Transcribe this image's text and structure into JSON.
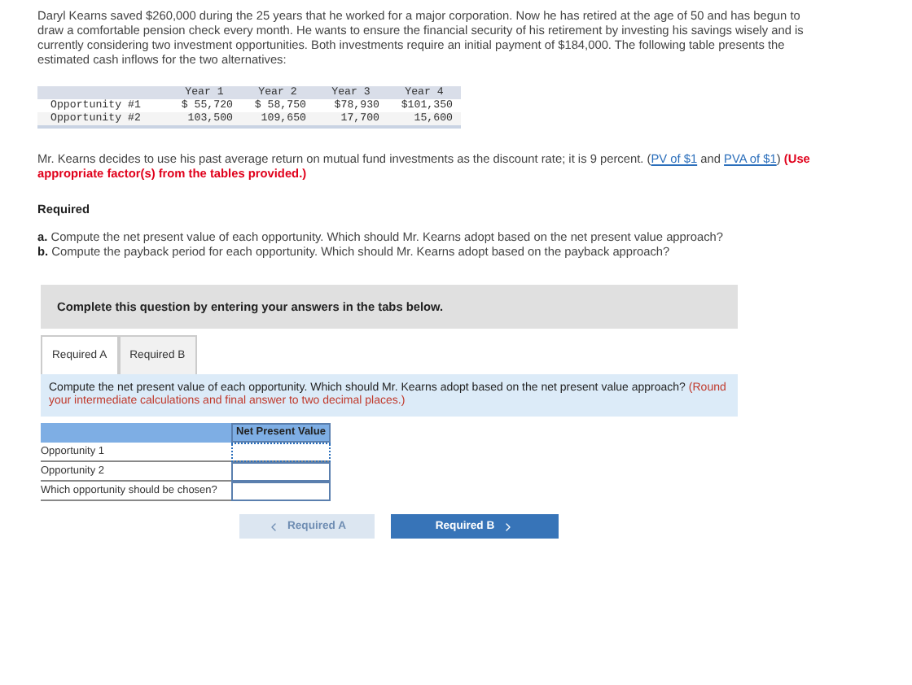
{
  "intro": "Daryl Kearns saved $260,000 during the 25 years that he worked for a major corporation. Now he has retired at the age of 50 and has begun to draw a comfortable pension check every month. He wants to ensure the financial security of his retirement by investing his savings wisely and is currently considering two investment opportunities. Both investments require an initial payment of $184,000. The following table presents the estimated cash inflows for the two alternatives:",
  "cash_table": {
    "columns": [
      "Year 1",
      "Year 2",
      "Year 3",
      "Year 4"
    ],
    "rows": [
      {
        "label": "Opportunity #1",
        "cells": [
          "$ 55,720",
          "$ 58,750",
          "$78,930",
          "$101,350"
        ]
      },
      {
        "label": "Opportunity #2",
        "cells": [
          "103,500",
          "109,650",
          "17,700",
          "15,600"
        ]
      }
    ]
  },
  "discount_text": "Mr. Kearns decides to use his past average return on mutual fund investments as the discount rate; it is 9 percent. (",
  "links": [
    "PV of $1",
    "PVA of $1"
  ],
  "link_joiner": " and ",
  "link_close": ")",
  "factor_note": "(Use appropriate factor(s) from the tables provided.)",
  "required_heading": "Required",
  "requirements": [
    {
      "marker": "a.",
      "text": "Compute the net present value of each opportunity. Which should Mr. Kearns adopt based on the net present value approach?"
    },
    {
      "marker": "b.",
      "text": "Compute the payback period for each opportunity. Which should Mr. Kearns adopt based on the payback approach?"
    }
  ],
  "banner": "Complete this question by entering your answers in the tabs below.",
  "tabs": [
    {
      "label": "Required A",
      "selected": true
    },
    {
      "label": "Required B",
      "selected": false
    }
  ],
  "instruction": "Compute the net present value of each opportunity. Which should Mr. Kearns adopt based on the net present value approach?",
  "instruction_note": "(Round your intermediate calculations and final answer to two decimal places.)",
  "answer_table": {
    "column": "Net Present Value",
    "rows": [
      {
        "label": "Opportunity 1",
        "focused": true
      },
      {
        "label": "Opportunity 2",
        "focused": false
      },
      {
        "label": "Which opportunity should be chosen?",
        "focused": false
      }
    ]
  },
  "nav": [
    {
      "kind": "prev",
      "label": "Required A",
      "disabled": true
    },
    {
      "kind": "next",
      "label": "Required B",
      "disabled": false
    }
  ]
}
